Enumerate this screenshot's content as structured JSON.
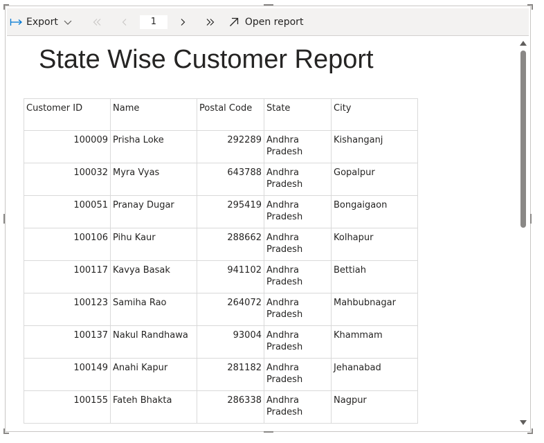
{
  "toolbar": {
    "export_label": "Export",
    "page_number": "1",
    "open_report_label": "Open report"
  },
  "report": {
    "title": "State Wise Customer Report",
    "columns": [
      "Customer ID",
      "Name",
      "Postal Code",
      "State",
      "City"
    ],
    "rows": [
      {
        "id": "100009",
        "name": "Prisha Loke",
        "postal": "292289",
        "state": "Andhra Pradesh",
        "city": "Kishanganj"
      },
      {
        "id": "100032",
        "name": "Myra Vyas",
        "postal": "643788",
        "state": "Andhra Pradesh",
        "city": "Gopalpur"
      },
      {
        "id": "100051",
        "name": "Pranay Dugar",
        "postal": "295419",
        "state": "Andhra Pradesh",
        "city": "Bongaigaon"
      },
      {
        "id": "100106",
        "name": "Pihu Kaur",
        "postal": "288662",
        "state": "Andhra Pradesh",
        "city": "Kolhapur"
      },
      {
        "id": "100117",
        "name": "Kavya Basak",
        "postal": "941102",
        "state": "Andhra Pradesh",
        "city": "Bettiah"
      },
      {
        "id": "100123",
        "name": "Samiha Rao",
        "postal": "264072",
        "state": "Andhra Pradesh",
        "city": "Mahbubnagar"
      },
      {
        "id": "100137",
        "name": "Nakul Randhawa",
        "postal": "93004",
        "state": "Andhra Pradesh",
        "city": "Khammam"
      },
      {
        "id": "100149",
        "name": "Anahi Kapur",
        "postal": "281182",
        "state": "Andhra Pradesh",
        "city": "Jehanabad"
      },
      {
        "id": "100155",
        "name": "Fateh Bhakta",
        "postal": "286338",
        "state": "Andhra Pradesh",
        "city": "Nagpur"
      }
    ]
  },
  "icons": {
    "export": "export-arrow-icon",
    "dropdown": "chevron-down-icon",
    "first": "first-page-icon",
    "prev": "previous-page-icon",
    "next": "next-page-icon",
    "last": "last-page-icon",
    "open": "open-external-icon"
  },
  "colors": {
    "accent": "#0078d4",
    "toolbar_bg": "#f3f2f1",
    "text": "#252423",
    "disabled": "#a19f9d",
    "grid": "#d9d9d9"
  }
}
